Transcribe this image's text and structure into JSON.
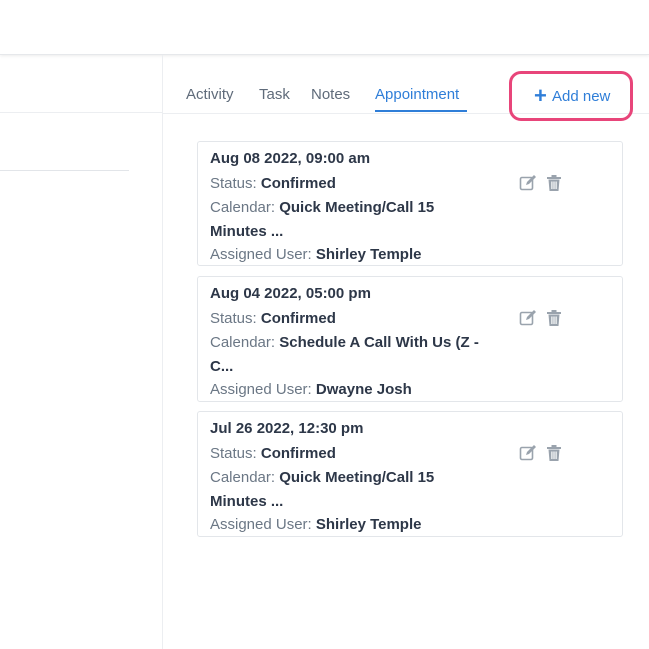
{
  "tabs": [
    {
      "label": "Activity",
      "active": false
    },
    {
      "label": "Task",
      "active": false
    },
    {
      "label": "Notes",
      "active": false
    },
    {
      "label": "Appointment",
      "active": true
    }
  ],
  "add_new": {
    "plus": "+",
    "label": "Add new"
  },
  "labels": {
    "status": "Status:",
    "calendar": "Calendar:",
    "assigned_user": "Assigned User:"
  },
  "appointments": [
    {
      "datetime": "Aug 08 2022, 09:00 am",
      "status": "Confirmed",
      "calendar": "Quick Meeting/Call 15 Minutes ...",
      "assigned_user": "Shirley Temple"
    },
    {
      "datetime": "Aug 04 2022, 05:00 pm",
      "status": "Confirmed",
      "calendar": "Schedule A Call With Us (Z - C...",
      "assigned_user": "Dwayne Josh"
    },
    {
      "datetime": "Jul 26 2022, 12:30 pm",
      "status": "Confirmed",
      "calendar": "Quick Meeting/Call 15 Minutes ...",
      "assigned_user": "Shirley Temple"
    }
  ],
  "icons": {
    "edit": "edit-icon",
    "delete": "trash-icon"
  },
  "colors": {
    "accent": "#2f7ed8",
    "highlight": "#e8457a",
    "icon": "#9aa3ad"
  }
}
